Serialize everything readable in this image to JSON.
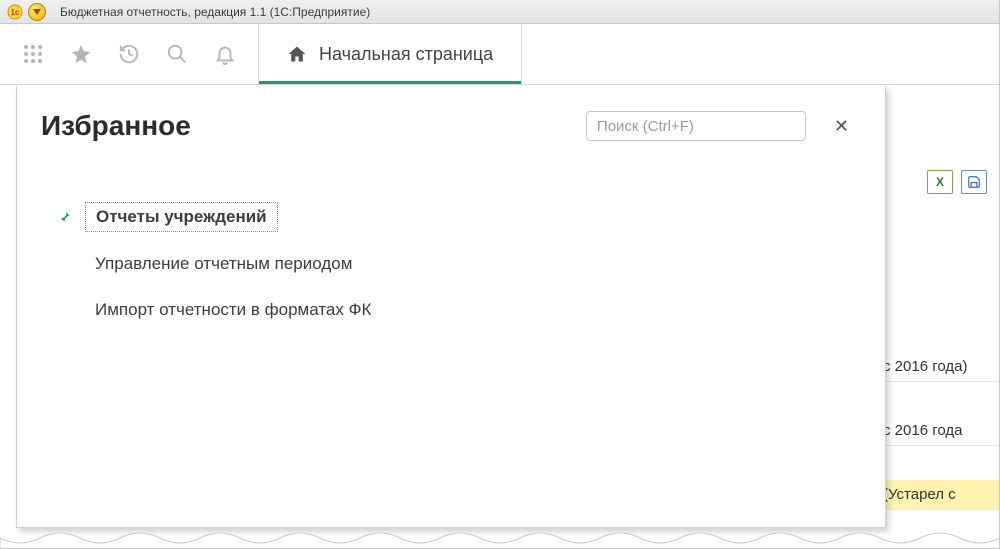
{
  "window": {
    "title": "Бюджетная отчетность, редакция 1.1  (1С:Предприятие)"
  },
  "toolbar": {
    "home_tab_label": "Начальная страница"
  },
  "favorites_panel": {
    "title": "Избранное",
    "search_placeholder": "Поиск (Ctrl+F)",
    "items": [
      {
        "label": "Отчеты учреждений",
        "pinned": true,
        "selected": true
      },
      {
        "label": "Управление отчетным периодом",
        "pinned": false,
        "selected": false
      },
      {
        "label": "Импорт отчетности в форматах ФК",
        "pinned": false,
        "selected": false
      }
    ]
  },
  "background_rows": {
    "row1": "с 2016 года)",
    "row2": "с 2016 года",
    "row3": "(Устарел с "
  },
  "icons": {
    "excel_label": "X"
  }
}
